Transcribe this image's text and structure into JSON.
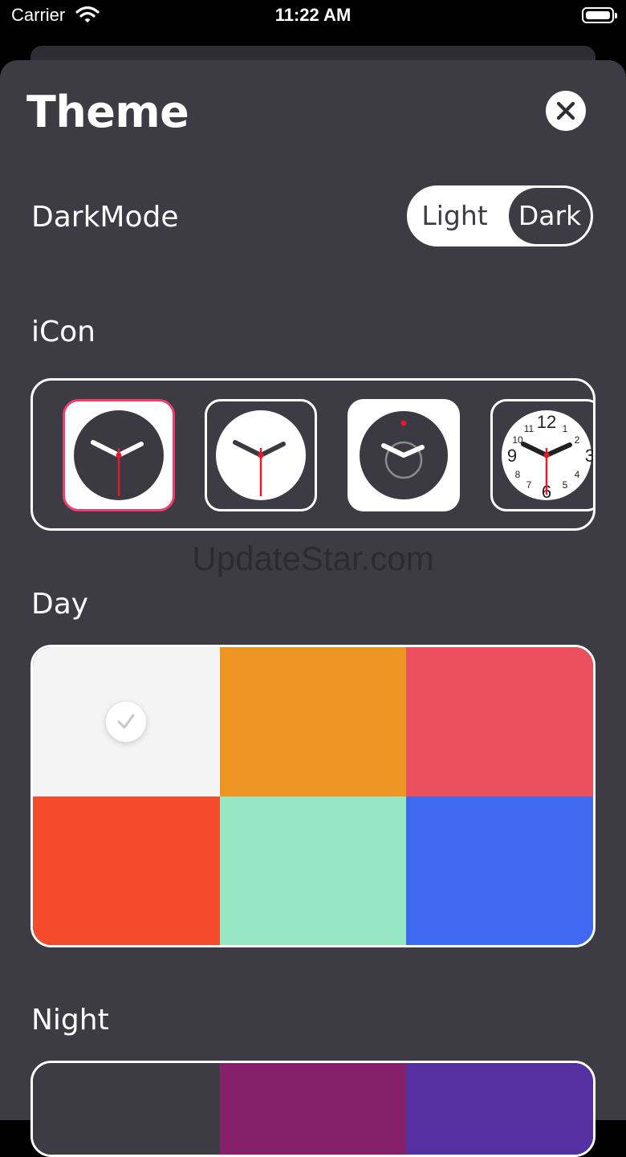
{
  "status_bar": {
    "carrier": "Carrier",
    "time": "11:22 AM"
  },
  "header": {
    "title": "Theme"
  },
  "dark_mode": {
    "label": "DarkMode",
    "options": [
      "Light",
      "Dark"
    ],
    "selected": "Dark"
  },
  "icon_section": {
    "label": "iCon",
    "icons": [
      "classic-dark-icon",
      "classic-light-icon",
      "minimal-dark-icon",
      "numbered-dial-icon"
    ],
    "selected": 0
  },
  "watermark": "UpdateStar.com",
  "day": {
    "label": "Day",
    "colors": [
      "#f4f4f4",
      "#ec9522",
      "#ec505e",
      "#f54b2d",
      "#95e8c3",
      "#3d6af0"
    ],
    "selected": 0
  },
  "night": {
    "label": "Night",
    "colors": [
      "#3d3c45",
      "#85216a",
      "#5530a0"
    ]
  },
  "accent": "#ee3e6c"
}
